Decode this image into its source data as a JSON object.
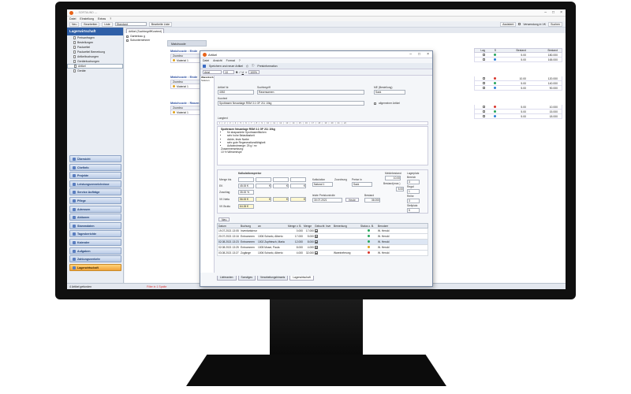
{
  "app": {
    "title": "--- SORTAUND ---",
    "menu": [
      "Datei",
      "Einstellung",
      "Extras",
      "?"
    ],
    "toolbar": {
      "new": "Neu",
      "edit": "Bearbeiten",
      "list": "Liste",
      "view": "Standard",
      "edit_list": "Bearbeite Liste",
      "assistant": "Assistent",
      "vk_use": "Verwendung in VK",
      "search": "Suchen"
    }
  },
  "sidebar": {
    "title": "Lagerwirtschaft",
    "tree": [
      "Preisanfragen",
      "Bestellungen",
      "Packzettel",
      "Packzettel Bemerkung",
      "Artikelbuchungen",
      "Gerätebuchungen",
      "Artikel",
      "Geräte"
    ],
    "selected_index": 6,
    "nav": [
      "Übersicht",
      "Chefinfo",
      "Projekte",
      "Leistungsverzeichnisse",
      "Service Aufträge",
      "Pflege",
      "Adressen",
      "Aktionen",
      "Stammdaten",
      "Tagesberichte",
      "Kalender",
      "Aufgaben",
      "Zahlungsverkehr",
      "Lagerwirtschaft"
    ],
    "active_nav_index": 13
  },
  "content": {
    "tab": "Artikel (SuchbegriffKurztext)",
    "tree": [
      "Gartenbau g",
      "Subunternehmer"
    ],
    "grid_tab": "Matchcode",
    "groups": [
      "Matchcode : Ende",
      "Matchcode : Ende",
      "Matchcode : Rasen"
    ],
    "mini_header": "Zuordnu",
    "mini_rows": [
      "Material 1",
      "Material 1",
      "Material 1"
    ],
    "right_header": [
      "Lag",
      "S",
      "Bestand",
      "Bestand"
    ],
    "right_rows": [
      {
        "val1": "5.00",
        "val2": "180.000",
        "color": "#26a65b"
      },
      {
        "val1": "5.00",
        "val2": "165.000",
        "color": "#2c7fd8"
      },
      {
        "val1": "10.00",
        "val2": "120.000",
        "color": "#d9352b"
      },
      {
        "val1": "5.00",
        "val2": "140.000",
        "color": "#26a65b"
      },
      {
        "val1": "5.00",
        "val2": "90.000",
        "color": "#2c7fd8"
      },
      {
        "val1": "5.00",
        "val2": "10.000",
        "color": "#d9352b"
      },
      {
        "val1": "5.00",
        "val2": "15.000",
        "color": "#26a65b"
      },
      {
        "val1": "5.00",
        "val2": "18.000",
        "color": "#2c7fd8"
      }
    ],
    "status_left": "4 Artikel gefunden",
    "status_filter": "Filter in 1 Spalte"
  },
  "dialog": {
    "title": "Artikel",
    "menu": [
      "Datei",
      "Ansicht",
      "Format",
      "?"
    ],
    "toolbar": {
      "save": "Speichern und neuer Artikel",
      "info": "Preisinformation"
    },
    "fmt": {
      "font": "Arial",
      "size": "10",
      "zoom": "100%"
    },
    "dock": [
      "Warenkorb",
      "Suturen"
    ],
    "article_no_label": "Artikel Nr.",
    "article_no": "4052",
    "search_label": "Suchbegriff",
    "search": "Rasensamen",
    "unit_label": "ME (Bestellung)",
    "unit": "Sack",
    "short_label": "Kurztext",
    "short": "Spottrasen Neuanlage RSM 3.1 GF 211 10kg",
    "general_label": "allgemeiner Artikel",
    "long_label": "Langtext",
    "ruler": "· 1 · | · 2 · | · 3 · | · 4 · | · 5 · | · 6 · | · 7 · | · 8 · | · 9 · | · 10 · | · 11 · | · 12 · | · 13 · | · 14 · | · 15 · | · 16 · | · 17 · | · 18 · | · 19 · | · 20 · | · 21 · | · 22 ·",
    "long_title": "Spottrasen Neuanlage RSM 3.1 GF 211 10kg",
    "long_bullets": [
      "für strapazierte Sportrasenflächen",
      "sehr hohe Belastbarkeit",
      "dichte, feste Narbe",
      "sehr gute Regenerationsfähigkeit",
      "Aufwandmenge: 25 g / m²"
    ],
    "composition_label": "Zusammensetzung:",
    "composition": "10 %         Wiesenrispe",
    "calc": {
      "title": "Kalkulationspreise",
      "qty_label": "Menge bis",
      "ek_label": "EK",
      "ek": "45.00 €",
      "extra_label": "Zuschlag",
      "extra": "35.00 %",
      "vknet_label": "VK Netto",
      "vknet": "56.00 €",
      "vkgross_label": "VK Brutto",
      "vkgross": "64.26 €",
      "euro": "€",
      "kalk_label": "Kalkulation",
      "kalk": "Natural 1",
      "assign_label": "Zuordnung",
      "price_in_label": "Preise in",
      "price_in": "Sack",
      "last_label": "letzte Preiskontrolle",
      "last": "30.07.2021",
      "stock_label": "Bestand",
      "stock": "36.000",
      "min_label": "Meldebestand",
      "min": "10.00",
      "max_label": "Bestand(max.)",
      "max": "5.00",
      "store_label": "Lagerplatz",
      "area_label": "Bereich",
      "area": "3",
      "shelf_label": "Regal",
      "shelf": "1",
      "row_label": "Reihe",
      "row": "3",
      "place_label": "Stellplatz",
      "place": "5",
      "heute_label": "Heute"
    },
    "new_btn": "Neu",
    "bookings": {
      "headers": [
        "Datum",
        "Buchung",
        "an",
        "Menge v. B.",
        "Menge",
        "Gebucht",
        "Inve",
        "Bemerkung",
        "Status o. B.",
        "Benutzer"
      ],
      "rows": [
        {
          "date": "19.07.2021 13:05",
          "type": "Inventarisierung",
          "to": "",
          "qty_before": "0.000",
          "qty": "17.000",
          "note": "",
          "status": "#26a65b",
          "user": "W. Herold"
        },
        {
          "date": "20.07.2021 13:16",
          "type": "Entnommen",
          "to": "1006 Scharlo, Alberto",
          "qty_before": "17.000",
          "qty": "5.000",
          "note": "",
          "status": "#26a65b",
          "user": "W. Herold"
        },
        {
          "date": "02.08.2021 13:23",
          "type": "Entnommen",
          "to": "1002 Zupfriesch, Maria",
          "qty_before": "12.000",
          "qty": "8.000",
          "note": "",
          "status": "#26a65b",
          "user": "W. Herold"
        },
        {
          "date": "02.08.2021 13:25",
          "type": "Entnommen",
          "to": "1005 Moser, Paula",
          "qty_before": "8.000",
          "qty": "4.000",
          "note": "",
          "status": "#e0a21c",
          "user": "W. Herold"
        },
        {
          "date": "03.08.2021 13:27",
          "type": "Zugänge",
          "to": "1006 Scharlo, Alberto",
          "qty_before": "4.000",
          "qty": "32.000",
          "note": "Wareineferung",
          "status": "#d9352b",
          "user": "W. Herold"
        }
      ]
    },
    "bottom_tabs": [
      "Lieferanten",
      "Sonstiges",
      "Verarbeitungshinweis",
      "Lagerwirtschaft"
    ],
    "active_bottom_tab": 3
  }
}
